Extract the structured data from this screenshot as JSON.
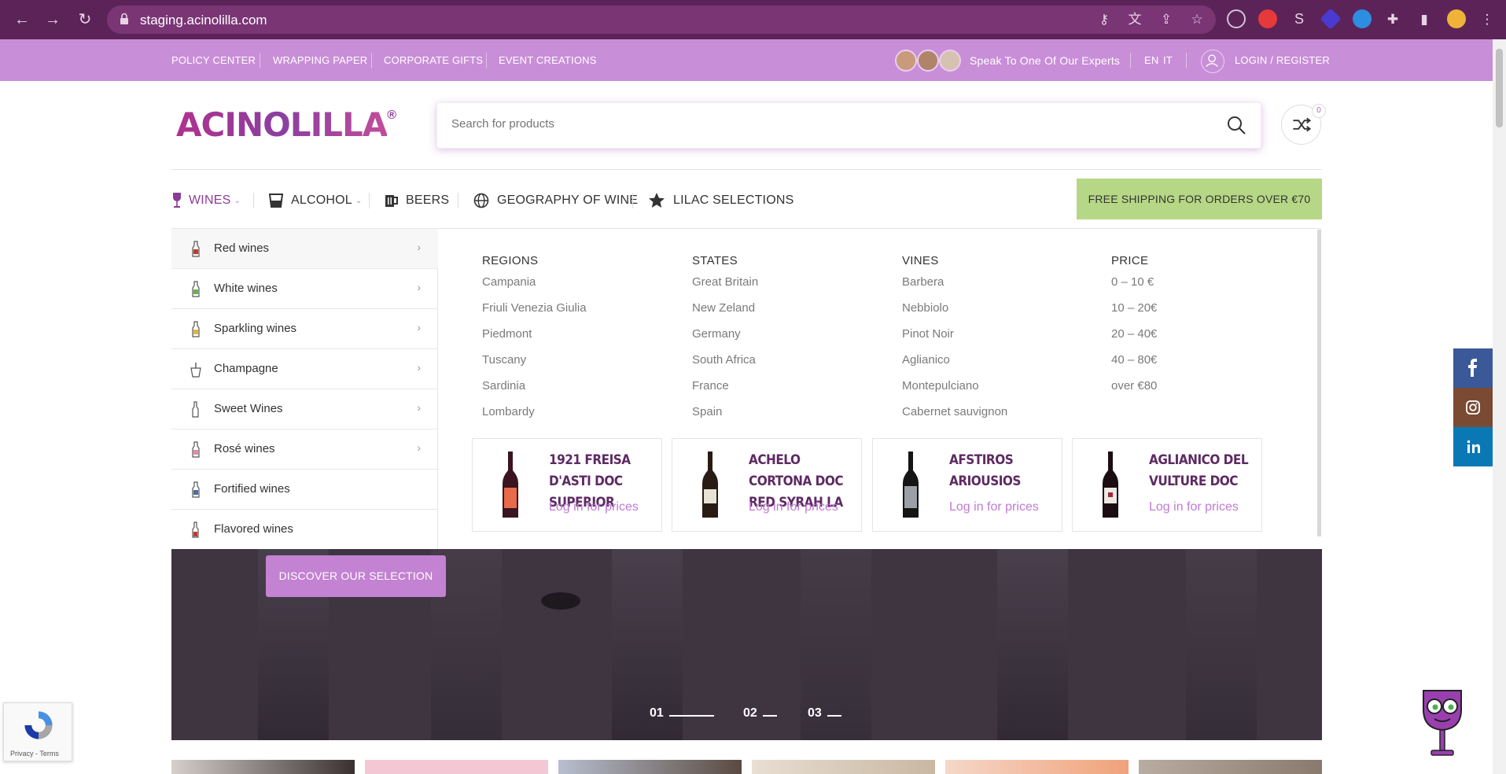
{
  "browser": {
    "url": "staging.acinolilla.com"
  },
  "topbar": {
    "links": [
      "POLICY CENTER",
      "WRAPPING PAPER",
      "CORPORATE GIFTS",
      "EVENT CREATIONS"
    ],
    "experts_label": "Speak To One Of Our Experts",
    "lang_en": "EN",
    "lang_it": "IT",
    "login_label": "LOGIN / REGISTER"
  },
  "header": {
    "logo_text": "ACINOLILLA",
    "logo_mark": "®",
    "search_placeholder": "Search for products",
    "compare_count": "0"
  },
  "nav": {
    "items": [
      "WINES",
      "ALCOHOL",
      "BEERS",
      "GEOGRAPHY OF WINE",
      "LILAC SELECTIONS"
    ],
    "shipping_banner": "FREE SHIPPING FOR ORDERS OVER €70"
  },
  "categories": [
    "Red wines",
    "White wines",
    "Sparkling wines",
    "Champagne",
    "Sweet Wines",
    "Rosé wines",
    "Fortified wines",
    "Flavored wines"
  ],
  "mega": {
    "regions": {
      "title": "REGIONS",
      "items": [
        "Campania",
        "Friuli Venezia Giulia",
        "Piedmont",
        "Tuscany",
        "Sardinia",
        "Lombardy"
      ]
    },
    "states": {
      "title": "STATES",
      "items": [
        "Great Britain",
        "New Zeland",
        "Germany",
        "South Africa",
        "France",
        "Spain"
      ]
    },
    "vines": {
      "title": "VINES",
      "items": [
        "Barbera",
        "Nebbiolo",
        "Pinot Noir",
        "Aglianico",
        "Montepulciano",
        "Cabernet sauvignon"
      ]
    },
    "price": {
      "title": "PRICE",
      "items": [
        "0 – 10 €",
        "10 – 20€",
        "20 – 40€",
        "40 – 80€",
        "over €80"
      ]
    }
  },
  "products": [
    {
      "name": "1921 FREISA D'ASTI DOC SUPERIOR",
      "price": "Log in for prices"
    },
    {
      "name": "ACHELO CORTONA DOC RED SYRAH LA",
      "price": "Log in for prices"
    },
    {
      "name": "AFSTIROS ARIOUSIOS",
      "price": "Log in for prices"
    },
    {
      "name": "AGLIANICO DEL VULTURE DOC",
      "price": "Log in for prices"
    }
  ],
  "hero": {
    "cta": "DISCOVER OUR SELECTION",
    "slides": [
      "01",
      "02",
      "03"
    ]
  },
  "recaptcha": {
    "text": "Privacy - Terms"
  },
  "colors": {
    "topbar": "#c98ed8",
    "brand_purple": "#8b3c96",
    "shipping_green": "#b6d785",
    "facebook": "#3b5998",
    "instagram": "#7a4a33",
    "linkedin": "#0a78b5"
  }
}
